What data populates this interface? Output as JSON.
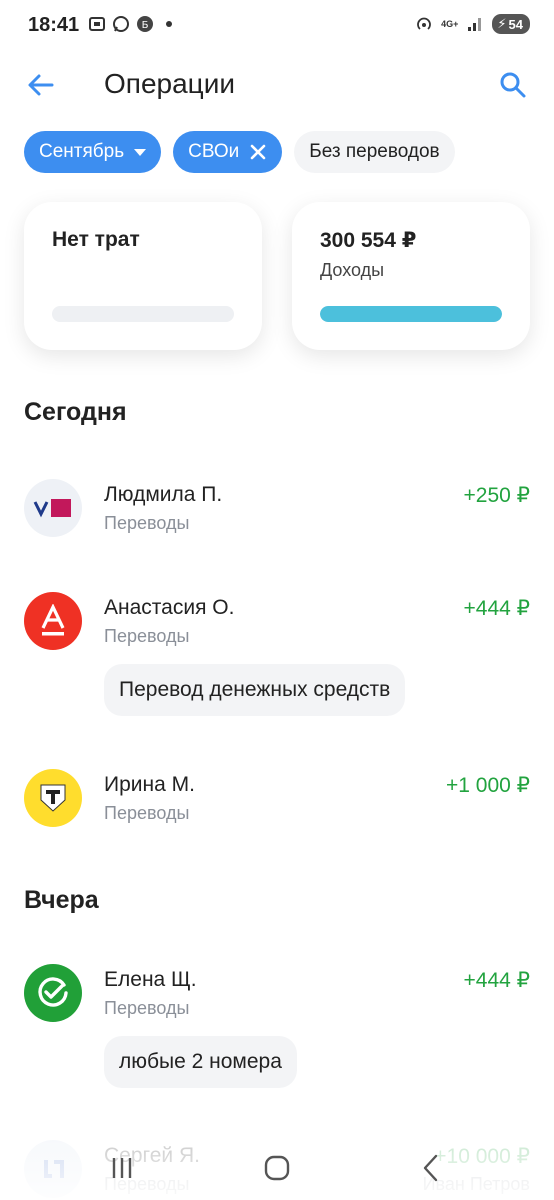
{
  "status": {
    "time": "18:41",
    "network": "4G+",
    "battery": "54"
  },
  "header": {
    "title": "Операции"
  },
  "filters": [
    {
      "label": "Сентябрь",
      "active": true
    },
    {
      "label": "СВОи",
      "active": true
    },
    {
      "label": "Без переводов",
      "active": false
    }
  ],
  "summary": {
    "spend": {
      "title": "Нет трат",
      "progress": 0
    },
    "income": {
      "title": "300 554 ₽",
      "subtitle": "Доходы",
      "progress": 1.0
    }
  },
  "sections": [
    {
      "title": "Сегодня",
      "items": [
        {
          "name": "Людмила П.",
          "category": "Переводы",
          "amount": "+250 ₽",
          "icon": "pochta-bank-logo",
          "bank_label": "ПОЧТА БАНК"
        },
        {
          "name": "Анастасия О.",
          "category": "Переводы",
          "amount": "+444 ₽",
          "icon": "alfa-bank-logo",
          "note": "Перевод денежных средств"
        },
        {
          "name": "Ирина М.",
          "category": "Переводы",
          "amount": "+1 000 ₽",
          "icon": "tbank-logo"
        }
      ]
    },
    {
      "title": "Вчера",
      "items": [
        {
          "name": "Елена Щ.",
          "category": "Переводы",
          "amount": "+444 ₽",
          "icon": "sber-logo",
          "note": "любые 2 номера"
        },
        {
          "name": "Сергей Я.",
          "category": "Переводы",
          "amount": "+10 000 ₽",
          "icon": "bank-logo",
          "extra": "Иван Петров"
        }
      ]
    }
  ],
  "colors": {
    "accent": "#3d8ef0",
    "income": "#22a33f",
    "progress": "#4cc0dc"
  }
}
